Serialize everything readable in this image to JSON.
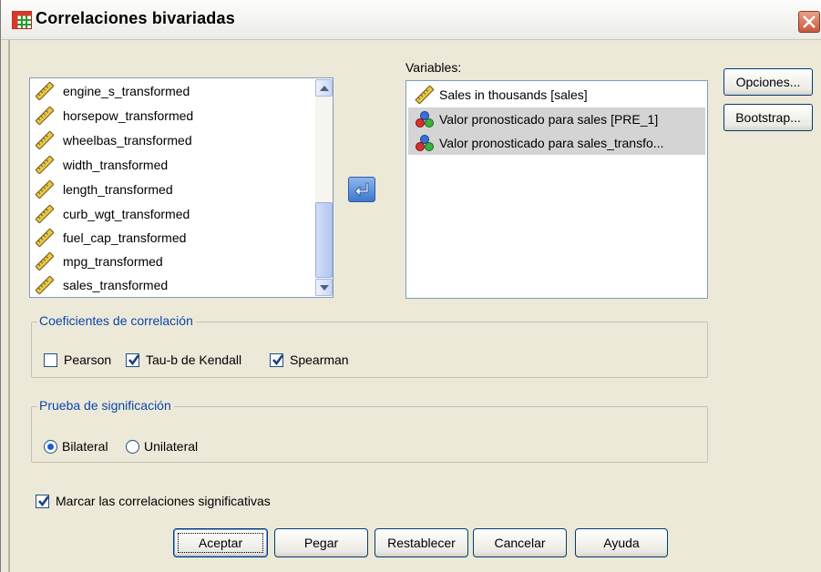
{
  "window": {
    "title": "Correlaciones bivariadas",
    "title_icon": "table-grid-icon",
    "close_icon": "close-icon"
  },
  "source_list": {
    "items": [
      {
        "label": "engine_s_transformed",
        "icon": "ruler-icon"
      },
      {
        "label": "horsepow_transformed",
        "icon": "ruler-icon"
      },
      {
        "label": "wheelbas_transformed",
        "icon": "ruler-icon"
      },
      {
        "label": "width_transformed",
        "icon": "ruler-icon"
      },
      {
        "label": "length_transformed",
        "icon": "ruler-icon"
      },
      {
        "label": "curb_wgt_transformed",
        "icon": "ruler-icon"
      },
      {
        "label": "fuel_cap_transformed",
        "icon": "ruler-icon"
      },
      {
        "label": "mpg_transformed",
        "icon": "ruler-icon"
      },
      {
        "label": "sales_transformed",
        "icon": "ruler-icon"
      }
    ]
  },
  "move_button_icon": "arrow-left-icon",
  "variables": {
    "label": "Variables:",
    "items": [
      {
        "label": "Sales in thousands [sales]",
        "icon": "ruler-icon",
        "selected": false
      },
      {
        "label": "Valor pronosticado para sales [PRE_1]",
        "icon": "nominal-balls-icon",
        "selected": true
      },
      {
        "label": "Valor pronosticado para sales_transfo...",
        "icon": "nominal-balls-icon",
        "selected": true
      }
    ]
  },
  "side_buttons": {
    "options": "Opciones...",
    "bootstrap": "Bootstrap..."
  },
  "coeficientes": {
    "legend": "Coeficientes de correlación",
    "pearson": {
      "label": "Pearson",
      "checked": false
    },
    "kendall": {
      "label": "Tau-b de Kendall",
      "checked": true
    },
    "spearman": {
      "label": "Spearman",
      "checked": true
    }
  },
  "prueba": {
    "legend": "Prueba de significación",
    "bilateral": {
      "label": "Bilateral",
      "selected": true
    },
    "unilateral": {
      "label": "Unilateral",
      "selected": false
    }
  },
  "marcar": {
    "label": "Marcar las correlaciones significativas",
    "checked": true
  },
  "buttons": {
    "aceptar": "Aceptar",
    "pegar": "Pegar",
    "restablecer": "Restablecer",
    "cancelar": "Cancelar",
    "ayuda": "Ayuda"
  },
  "colors": {
    "dialog_bg": "#ece9d8",
    "group_legend": "#0c46a8",
    "selection_bg": "#d4d4d4",
    "close_button": "#c9573a",
    "arrow_button": "#3f76cc"
  }
}
